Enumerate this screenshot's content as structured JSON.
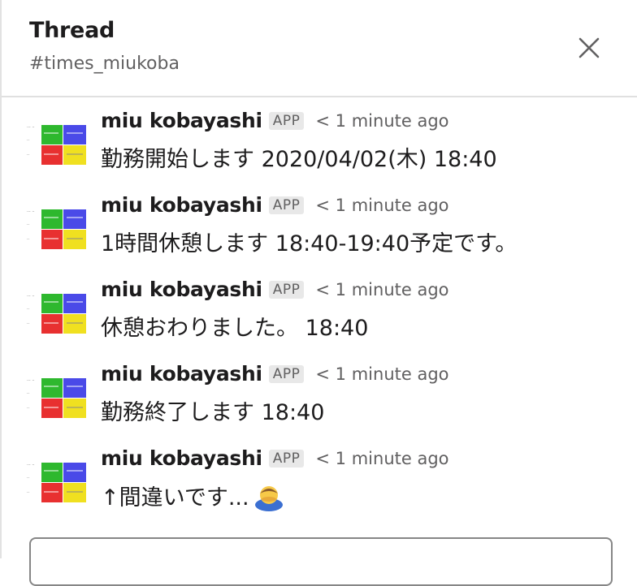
{
  "header": {
    "title": "Thread",
    "channel": "#times_miukoba"
  },
  "messages": [
    {
      "author": "miu kobayashi",
      "badge": "APP",
      "time": "< 1 minute ago",
      "text": "勤務開始します 2020/04/02(木) 18:40"
    },
    {
      "author": "miu kobayashi",
      "badge": "APP",
      "time": "< 1 minute ago",
      "text": "1時間休憩します 18:40-19:40予定です。"
    },
    {
      "author": "miu kobayashi",
      "badge": "APP",
      "time": "< 1 minute ago",
      "text": "休憩おわりました。 18:40"
    },
    {
      "author": "miu kobayashi",
      "badge": "APP",
      "time": "< 1 minute ago",
      "text": "勤務終了します 18:40"
    },
    {
      "author": "miu kobayashi",
      "badge": "APP",
      "time": "< 1 minute ago",
      "text": "↑間違いです...",
      "emoji": "bowing-person-emoji"
    }
  ],
  "icons": {
    "close": "close-icon",
    "avatar": "app-avatar"
  },
  "colors": {
    "text": "#1d1c1d",
    "muted": "#616061",
    "badge_bg": "#e8e8e8",
    "divider": "#e0e0e0",
    "avatar_green": "#2eb82e",
    "avatar_blue": "#4a4ae8",
    "avatar_red": "#e83030",
    "avatar_yellow": "#f0e020"
  }
}
